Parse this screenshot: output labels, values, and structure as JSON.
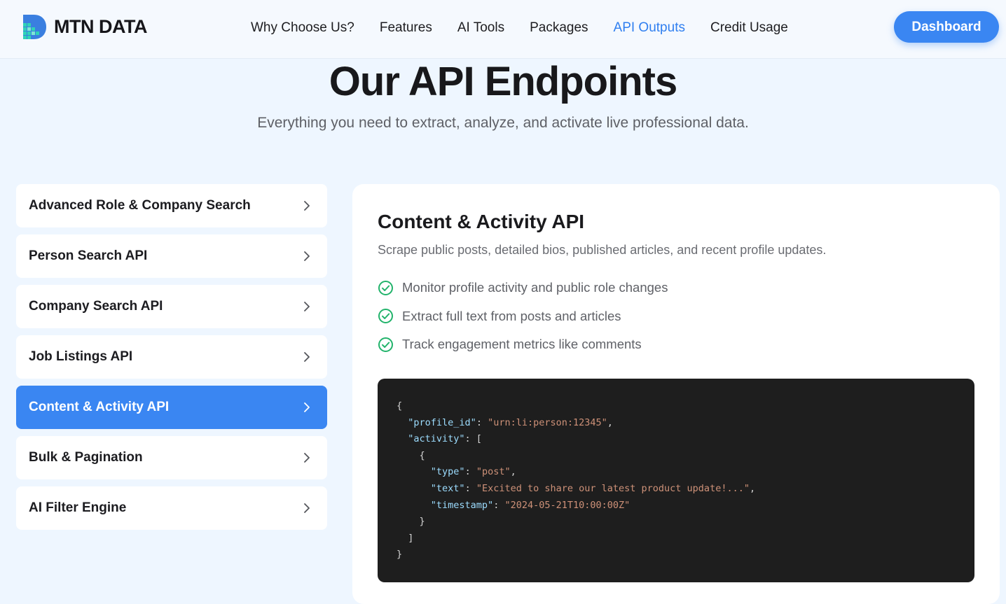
{
  "header": {
    "brand": "MTN DATA",
    "nav": [
      {
        "label": "Why Choose Us?",
        "active": false
      },
      {
        "label": "Features",
        "active": false
      },
      {
        "label": "AI Tools",
        "active": false
      },
      {
        "label": "Packages",
        "active": false
      },
      {
        "label": "API Outputs",
        "active": true
      },
      {
        "label": "Credit Usage",
        "active": false
      }
    ],
    "dashboard_label": "Dashboard"
  },
  "hero": {
    "title_part1": "Our API ",
    "title_highlight": "Endpoints",
    "subtitle": "Everything you need to extract, analyze, and activate live professional data."
  },
  "sidebar": {
    "items": [
      {
        "label": "Advanced Role & Company Search",
        "active": false
      },
      {
        "label": "Person Search API",
        "active": false
      },
      {
        "label": "Company Search API",
        "active": false
      },
      {
        "label": "Job Listings API",
        "active": false
      },
      {
        "label": "Content & Activity API",
        "active": true
      },
      {
        "label": "Bulk & Pagination",
        "active": false
      },
      {
        "label": "AI Filter Engine",
        "active": false
      }
    ],
    "chevron_icon": "chevron-right-icon"
  },
  "panel": {
    "title": "Content & Activity API",
    "description": "Scrape public posts, detailed bios, published articles, and recent profile updates.",
    "features": [
      "Monitor profile activity and public role changes",
      "Extract full text from posts and articles",
      "Track engagement metrics like comments"
    ],
    "code": {
      "profile_id_key": "\"profile_id\"",
      "profile_id_val": "\"urn:li:person:12345\"",
      "activity_key": "\"activity\"",
      "type_key": "\"type\"",
      "type_val": "\"post\"",
      "text_key": "\"text\"",
      "text_val": "\"Excited to share our latest product update!...\"",
      "timestamp_key": "\"timestamp\"",
      "timestamp_val": "\"2024-05-21T10:00:00Z\""
    }
  },
  "colors": {
    "accent": "#3a86f2",
    "background": "#eef6ff",
    "check": "#22b36b",
    "code_bg": "#1e1e1e",
    "code_key": "#9cdcfe",
    "code_string": "#ce9178"
  }
}
